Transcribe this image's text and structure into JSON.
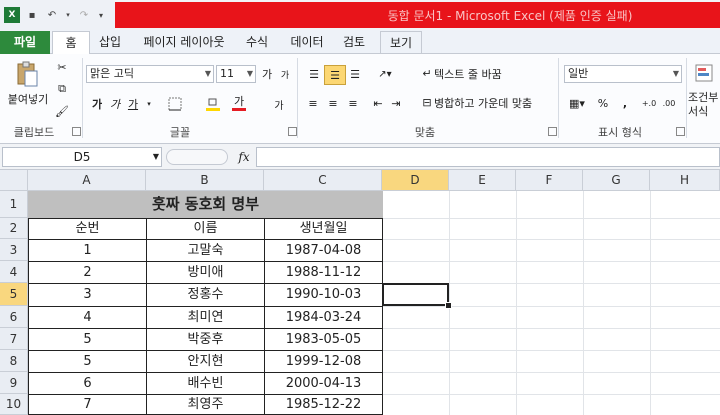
{
  "window": {
    "title": "동합 문서1 - Microsoft Excel (제품 인증 실패)"
  },
  "tabs": [
    {
      "label": "파일"
    },
    {
      "label": "홈"
    },
    {
      "label": "삽입"
    },
    {
      "label": "페이지 레이아웃"
    },
    {
      "label": "수식"
    },
    {
      "label": "데이터"
    },
    {
      "label": "검토"
    },
    {
      "label": "보기"
    }
  ],
  "ribbon": {
    "clipboard": {
      "paste_label": "붙여넣기",
      "group_label": "클립보드"
    },
    "font": {
      "name": "맑은 고딕",
      "size": "11",
      "group_label": "글꼴",
      "bold": "가",
      "italic": "가",
      "underline": "가",
      "grow": "가",
      "shrink": "가",
      "color_a": "가",
      "ga": "가"
    },
    "alignment": {
      "wrap_label": "텍스트 줄 바꿈",
      "merge_label": "병합하고 가운데 맞춤",
      "group_label": "맞춤"
    },
    "number": {
      "format": "일반",
      "group_label": "표시 형식",
      "percent": "%",
      "comma": ","
    },
    "styles": {
      "label1": "조건부",
      "label2": "서식"
    }
  },
  "formula_bar": {
    "name_box": "D5",
    "fx": "fx",
    "value": ""
  },
  "sheet": {
    "columns": [
      "A",
      "B",
      "C",
      "D",
      "E",
      "F",
      "G",
      "H"
    ],
    "rows": [
      "1",
      "2",
      "3",
      "4",
      "5",
      "6",
      "7",
      "8",
      "9",
      "10"
    ],
    "active_cell": "D5",
    "table": {
      "title": "훗짜 동호회 명부",
      "headers": [
        "순번",
        "이름",
        "생년월일"
      ],
      "records": [
        [
          "1",
          "고말숙",
          "1987-04-08"
        ],
        [
          "2",
          "방미애",
          "1988-11-12"
        ],
        [
          "3",
          "정홍수",
          "1990-10-03"
        ],
        [
          "4",
          "최미연",
          "1984-03-24"
        ],
        [
          "5",
          "박중후",
          "1983-05-05"
        ],
        [
          "5",
          "안지현",
          "1999-12-08"
        ],
        [
          "6",
          "배수빈",
          "2000-04-13"
        ],
        [
          "7",
          "최영주",
          "1985-12-22"
        ]
      ]
    }
  },
  "colors": {
    "file_tab": "#2d8a3c",
    "title_red": "#e8141a",
    "active_header": "#f9d77f"
  }
}
